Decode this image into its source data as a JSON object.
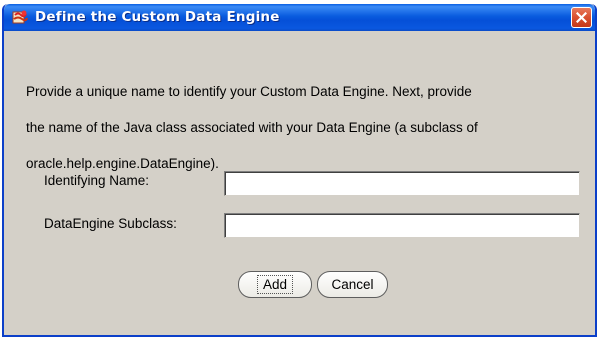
{
  "window": {
    "title": "Define the Custom Data Engine",
    "icon": "app-icon",
    "close_icon": "close-icon"
  },
  "description": {
    "lines": [
      "Provide a unique name to identify your Custom Data Engine. Next, provide",
      "the name of the Java class associated with your Data Engine (a subclass of",
      "oracle.help.engine.DataEngine)."
    ]
  },
  "form": {
    "identifying_name": {
      "label": "Identifying Name:",
      "value": ""
    },
    "dataengine_subclass": {
      "label": "DataEngine Subclass:",
      "value": ""
    }
  },
  "buttons": {
    "add_label": "Add",
    "cancel_label": "Cancel"
  },
  "colors": {
    "title_bar": "#0a5cdf",
    "close_button": "#d9502f",
    "dialog_background": "#d4d0c8"
  }
}
